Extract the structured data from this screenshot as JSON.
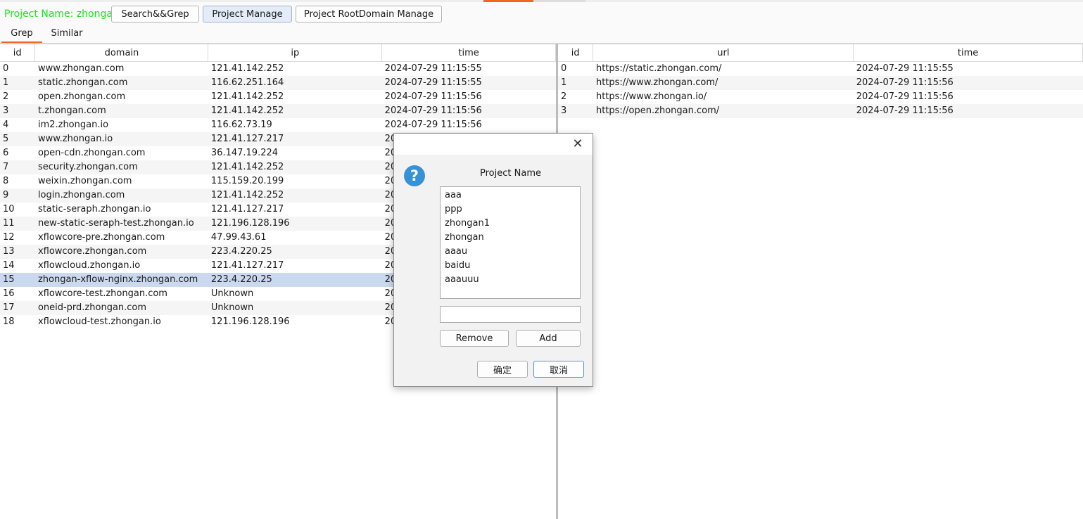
{
  "toolbar": {
    "project_label": "Project Name: zhongan",
    "buttons": [
      "Search&&Grep",
      "Project Manage",
      "Project RootDomain Manage"
    ]
  },
  "tabs": [
    "Grep",
    "Similar"
  ],
  "left_table": {
    "columns": [
      "id",
      "domain",
      "ip",
      "time"
    ],
    "rows": [
      [
        "0",
        "www.zhongan.com",
        "121.41.142.252",
        "2024-07-29 11:15:55"
      ],
      [
        "1",
        "static.zhongan.com",
        "116.62.251.164",
        "2024-07-29 11:15:55"
      ],
      [
        "2",
        "open.zhongan.com",
        "121.41.142.252",
        "2024-07-29 11:15:56"
      ],
      [
        "3",
        "t.zhongan.com",
        "121.41.142.252",
        "2024-07-29 11:15:56"
      ],
      [
        "4",
        "im2.zhongan.io",
        "116.62.73.19",
        "2024-07-29 11:15:56"
      ],
      [
        "5",
        "www.zhongan.io",
        "121.41.127.217",
        "20"
      ],
      [
        "6",
        "open-cdn.zhongan.com",
        "36.147.19.224",
        "20"
      ],
      [
        "7",
        "security.zhongan.com",
        "121.41.142.252",
        "20"
      ],
      [
        "8",
        "weixin.zhongan.com",
        "115.159.20.199",
        "20"
      ],
      [
        "9",
        "login.zhongan.com",
        "121.41.142.252",
        "20"
      ],
      [
        "10",
        "static-seraph.zhongan.io",
        "121.41.127.217",
        "20"
      ],
      [
        "11",
        "new-static-seraph-test.zhongan.io",
        "121.196.128.196",
        "20"
      ],
      [
        "12",
        "xflowcore-pre.zhongan.com",
        "47.99.43.61",
        "20"
      ],
      [
        "13",
        "xflowcore.zhongan.com",
        "223.4.220.25",
        "20"
      ],
      [
        "14",
        "xflowcloud.zhongan.io",
        "121.41.127.217",
        "20"
      ],
      [
        "15",
        "zhongan-xflow-nginx.zhongan.com",
        "223.4.220.25",
        "20"
      ],
      [
        "16",
        "xflowcore-test.zhongan.com",
        "Unknown",
        "20"
      ],
      [
        "17",
        "oneid-prd.zhongan.com",
        "Unknown",
        "20"
      ],
      [
        "18",
        "xflowcloud-test.zhongan.io",
        "121.196.128.196",
        "20"
      ]
    ],
    "selected_row_id": "15"
  },
  "right_table": {
    "columns": [
      "id",
      "url",
      "time"
    ],
    "rows": [
      [
        "0",
        "https://static.zhongan.com/",
        "2024-07-29 11:15:55"
      ],
      [
        "1",
        "https://www.zhongan.com/",
        "2024-07-29 11:15:56"
      ],
      [
        "2",
        "https://www.zhongan.io/",
        "2024-07-29 11:15:56"
      ],
      [
        "3",
        "https://open.zhongan.com/",
        "2024-07-29 11:15:56"
      ]
    ]
  },
  "dialog": {
    "close_symbol": "✕",
    "help_symbol": "?",
    "heading": "Project Name",
    "projects": [
      "aaa",
      "ppp",
      "zhongan1",
      "zhongan",
      "aaau",
      "baidu",
      "aaauuu"
    ],
    "input_value": "",
    "remove_label": "Remove",
    "add_label": "Add",
    "ok_label": "确定",
    "cancel_label": "取消"
  },
  "colors": {
    "project_label": "#1fe01f",
    "tab_accent": "#f26522",
    "selected_row": "#cbd9ef",
    "help_icon": "#3592d6"
  }
}
